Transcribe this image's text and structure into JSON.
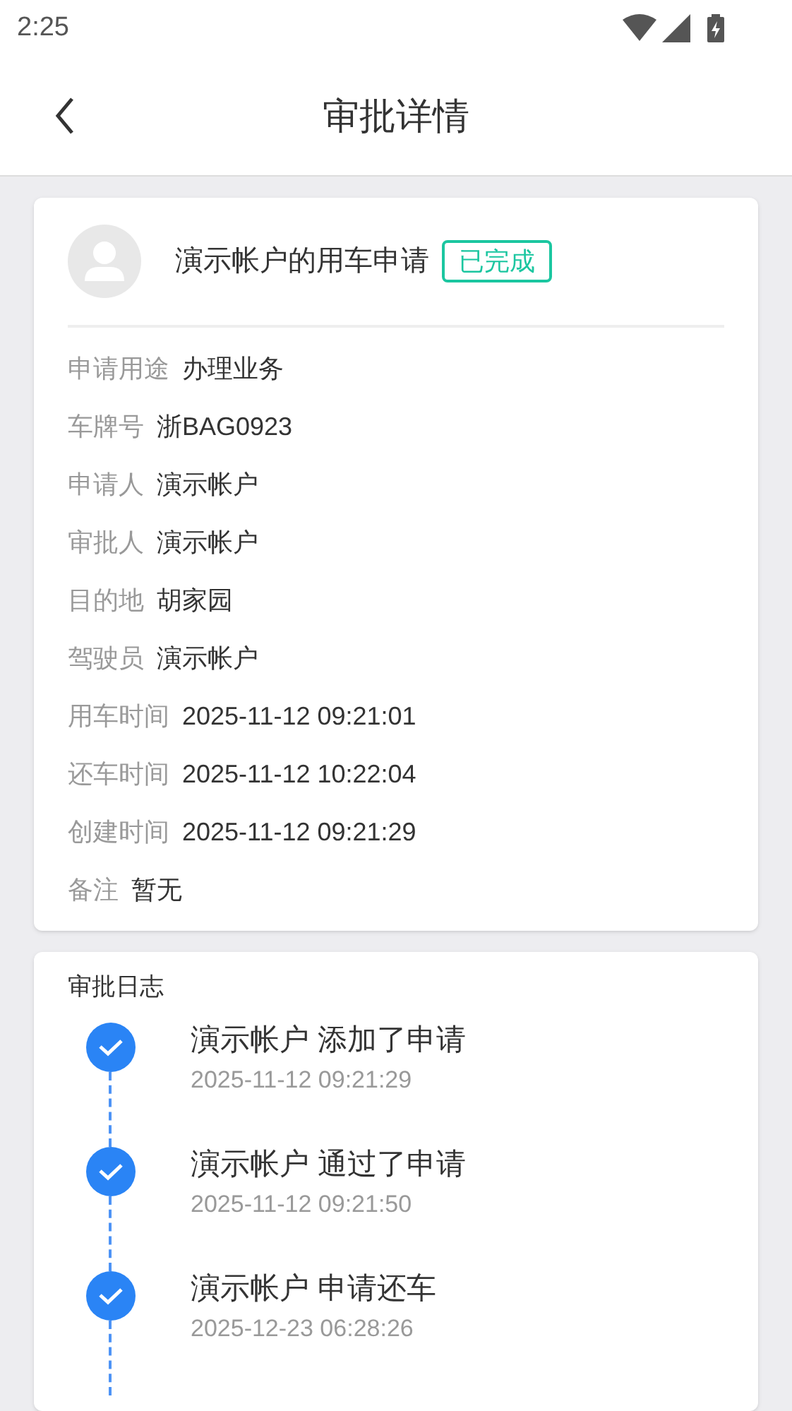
{
  "status_bar": {
    "time": "2:25"
  },
  "header": {
    "title": "审批详情"
  },
  "request": {
    "title": "演示帐户的用车申请",
    "status": "已完成",
    "fields": [
      {
        "label": "申请用途",
        "value": "办理业务"
      },
      {
        "label": "车牌号",
        "value": "浙BAG0923"
      },
      {
        "label": "申请人",
        "value": "演示帐户"
      },
      {
        "label": "审批人",
        "value": "演示帐户"
      },
      {
        "label": "目的地",
        "value": "胡家园"
      },
      {
        "label": "驾驶员",
        "value": "演示帐户"
      },
      {
        "label": "用车时间",
        "value": "2025-11-12 09:21:01"
      },
      {
        "label": "还车时间",
        "value": "2025-11-12 10:22:04"
      },
      {
        "label": "创建时间",
        "value": "2025-11-12 09:21:29"
      },
      {
        "label": "备注",
        "value": "暂无"
      }
    ]
  },
  "log": {
    "title": "审批日志",
    "entries": [
      {
        "text": "演示帐户 添加了申请",
        "time": "2025-11-12 09:21:29"
      },
      {
        "text": "演示帐户 通过了申请",
        "time": "2025-11-12 09:21:50"
      },
      {
        "text": "演示帐户 申请还车",
        "time": "2025-12-23 06:28:26"
      }
    ]
  }
}
